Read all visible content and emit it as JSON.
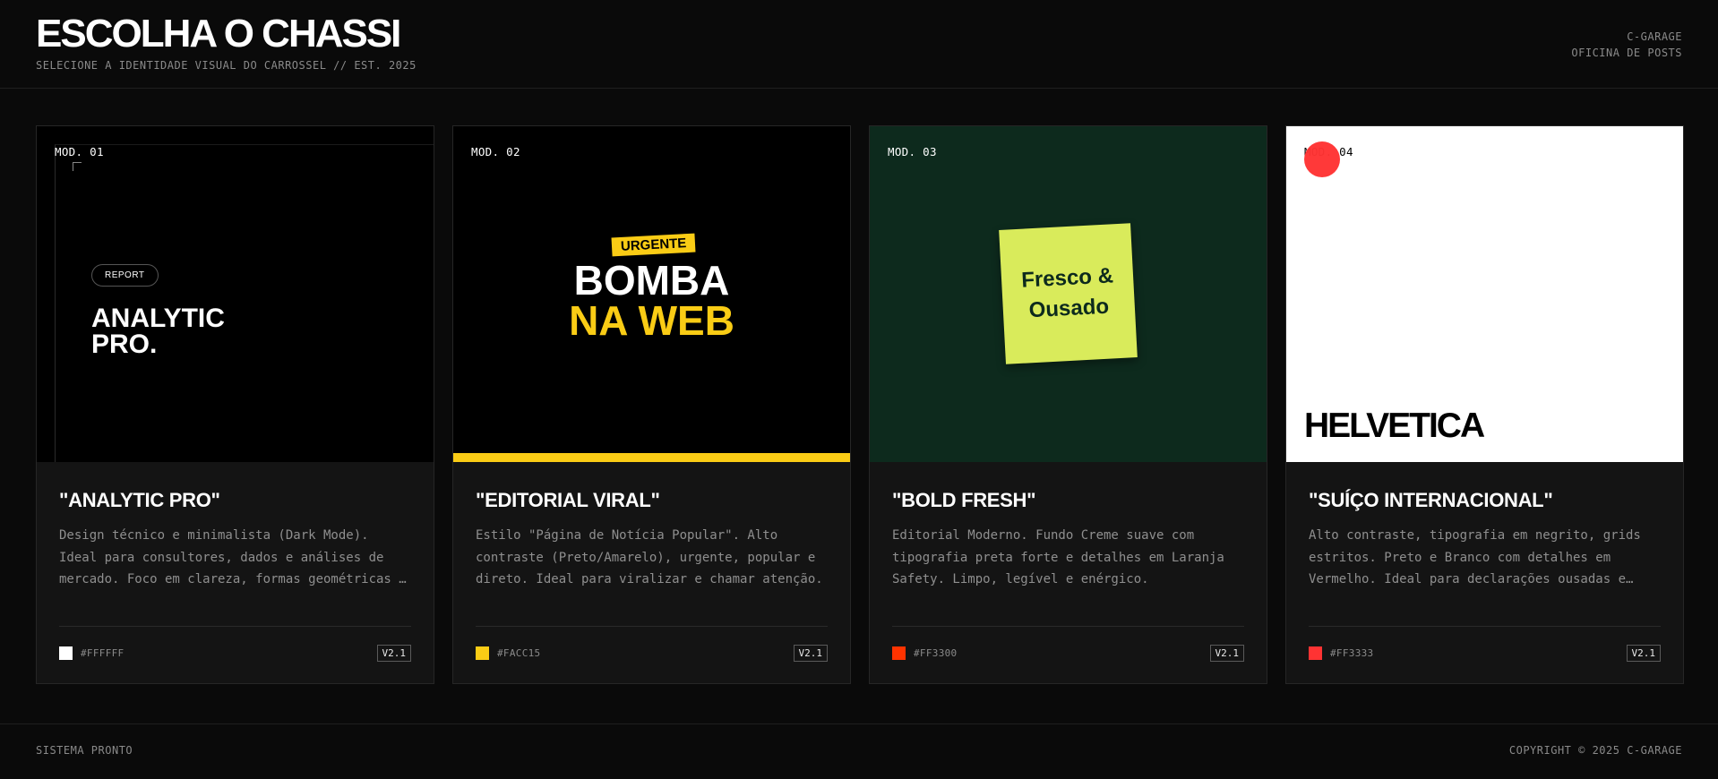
{
  "header": {
    "title": "ESCOLHA O CHASSI",
    "subtitle": "SELECIONE A IDENTIDADE VISUAL DO CARROSSEL // EST. 2025",
    "brand_line1": "C-GARAGE",
    "brand_line2": "OFICINA DE POSTS"
  },
  "cards": [
    {
      "mod": "MOD. 01",
      "preview": {
        "tag": "REPORT",
        "line1": "ANALYTIC",
        "line2": "PRO."
      },
      "title": "\"ANALYTIC PRO\"",
      "description": "Design técnico e minimalista (Dark Mode). Ideal para consultores, dados e análises de mercado. Foco em clareza, formas geométricas e dados.",
      "accent_color": "#FFFFFF",
      "hex_label": "#FFFFFF",
      "version": "V2.1"
    },
    {
      "mod": "MOD. 02",
      "preview": {
        "tag": "URGENTE",
        "line1": "BOMBA",
        "line2": "NA WEB"
      },
      "title": "\"EDITORIAL VIRAL\"",
      "description": "Estilo \"Página de Notícia Popular\". Alto contraste (Preto/Amarelo), urgente, popular e direto. Ideal para viralizar e chamar atenção.",
      "accent_color": "#FACC15",
      "hex_label": "#FACC15",
      "version": "V2.1"
    },
    {
      "mod": "MOD. 03",
      "preview": {
        "line1": "Fresco &",
        "line2": "Ousado"
      },
      "title": "\"BOLD FRESH\"",
      "description": "Editorial Moderno. Fundo Creme suave com tipografia preta forte e detalhes em Laranja Safety. Limpo, legível e enérgico.",
      "accent_color": "#FF3300",
      "hex_label": "#FF3300",
      "version": "V2.1"
    },
    {
      "mod": "MOD. 04",
      "preview": {
        "line1": "HELVETICA"
      },
      "title": "\"SUÍÇO INTERNACIONAL\"",
      "description": "Alto contraste, tipografia em negrito, grids estritos. Preto e Branco com detalhes em Vermelho. Ideal para declarações ousadas e impactantes.",
      "accent_color": "#FF3333",
      "hex_label": "#FF3333",
      "version": "V2.1"
    }
  ],
  "footer": {
    "status": "SISTEMA PRONTO",
    "copyright": "COPYRIGHT © 2025 C-GARAGE"
  }
}
